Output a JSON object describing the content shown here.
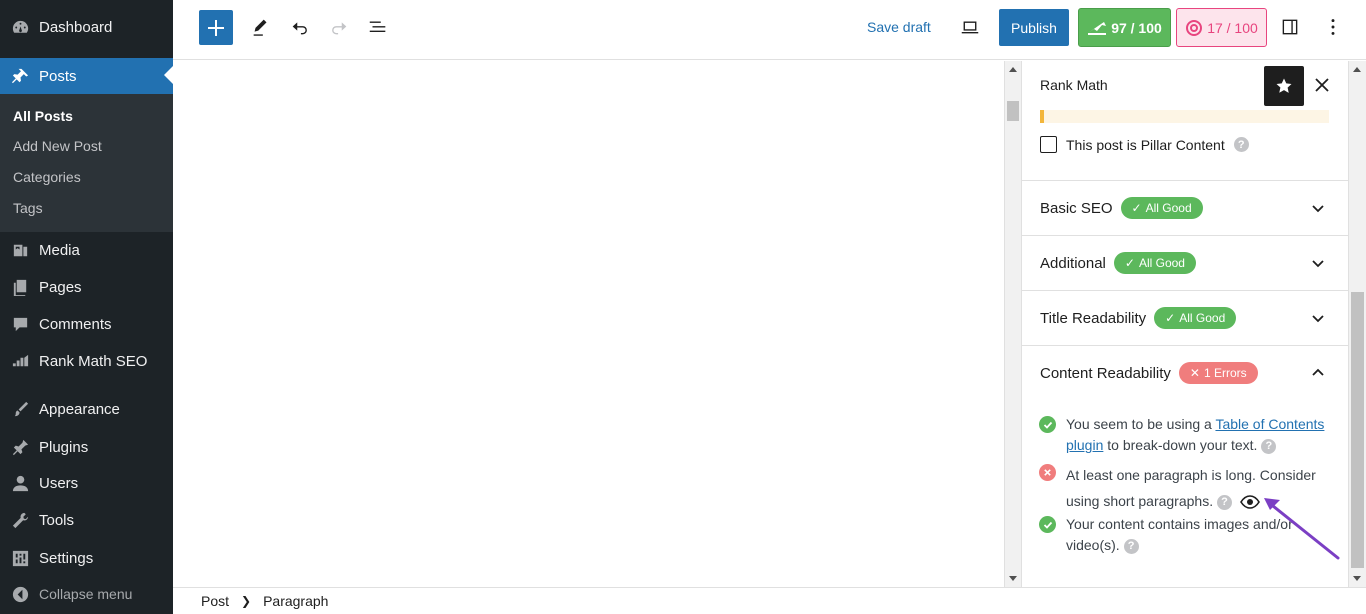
{
  "sidebar": {
    "items": [
      {
        "label": "Dashboard",
        "icon": "dashboard-icon"
      },
      {
        "label": "Posts",
        "icon": "pushpin-icon"
      },
      {
        "label": "Media",
        "icon": "media-icon"
      },
      {
        "label": "Pages",
        "icon": "pages-icon"
      },
      {
        "label": "Comments",
        "icon": "comments-icon"
      },
      {
        "label": "Rank Math SEO",
        "icon": "rank-math-icon"
      },
      {
        "label": "Appearance",
        "icon": "paintbrush-icon"
      },
      {
        "label": "Plugins",
        "icon": "plugin-icon"
      },
      {
        "label": "Users",
        "icon": "users-icon"
      },
      {
        "label": "Tools",
        "icon": "wrench-icon"
      },
      {
        "label": "Settings",
        "icon": "settings-icon"
      }
    ],
    "submenu": [
      "All Posts",
      "Add New Post",
      "Categories",
      "Tags"
    ],
    "collapse_label": "Collapse menu"
  },
  "toolbar": {
    "save_draft": "Save draft",
    "publish": "Publish",
    "seo_score": "97 / 100",
    "content_score": "17 / 100"
  },
  "panel": {
    "title": "Rank Math",
    "pillar_label": "This post is Pillar Content",
    "help_glyph": "?",
    "sections": [
      {
        "label": "Basic SEO",
        "badge": "All Good",
        "status": "good"
      },
      {
        "label": "Additional",
        "badge": "All Good",
        "status": "good"
      },
      {
        "label": "Title Readability",
        "badge": "All Good",
        "status": "good"
      },
      {
        "label": "Content Readability",
        "badge": "1 Errors",
        "status": "error"
      }
    ],
    "checks": {
      "toc_prefix": "You seem to be using a ",
      "toc_link": "Table of Contents plugin",
      "toc_suffix": " to break-down your text.",
      "paragraph": "At least one paragraph is long. Consider using short paragraphs.",
      "images": "Your content contains images and/or video(s)."
    }
  },
  "footer": {
    "crumb1": "Post",
    "crumb2": "Paragraph"
  },
  "colors": {
    "wp_blue": "#2271b1",
    "sidebar_bg": "#1d2327",
    "good": "#5cb85c",
    "error": "#f07d7d",
    "content_ai": "#e8457f",
    "annotation": "#7b3fc4"
  }
}
